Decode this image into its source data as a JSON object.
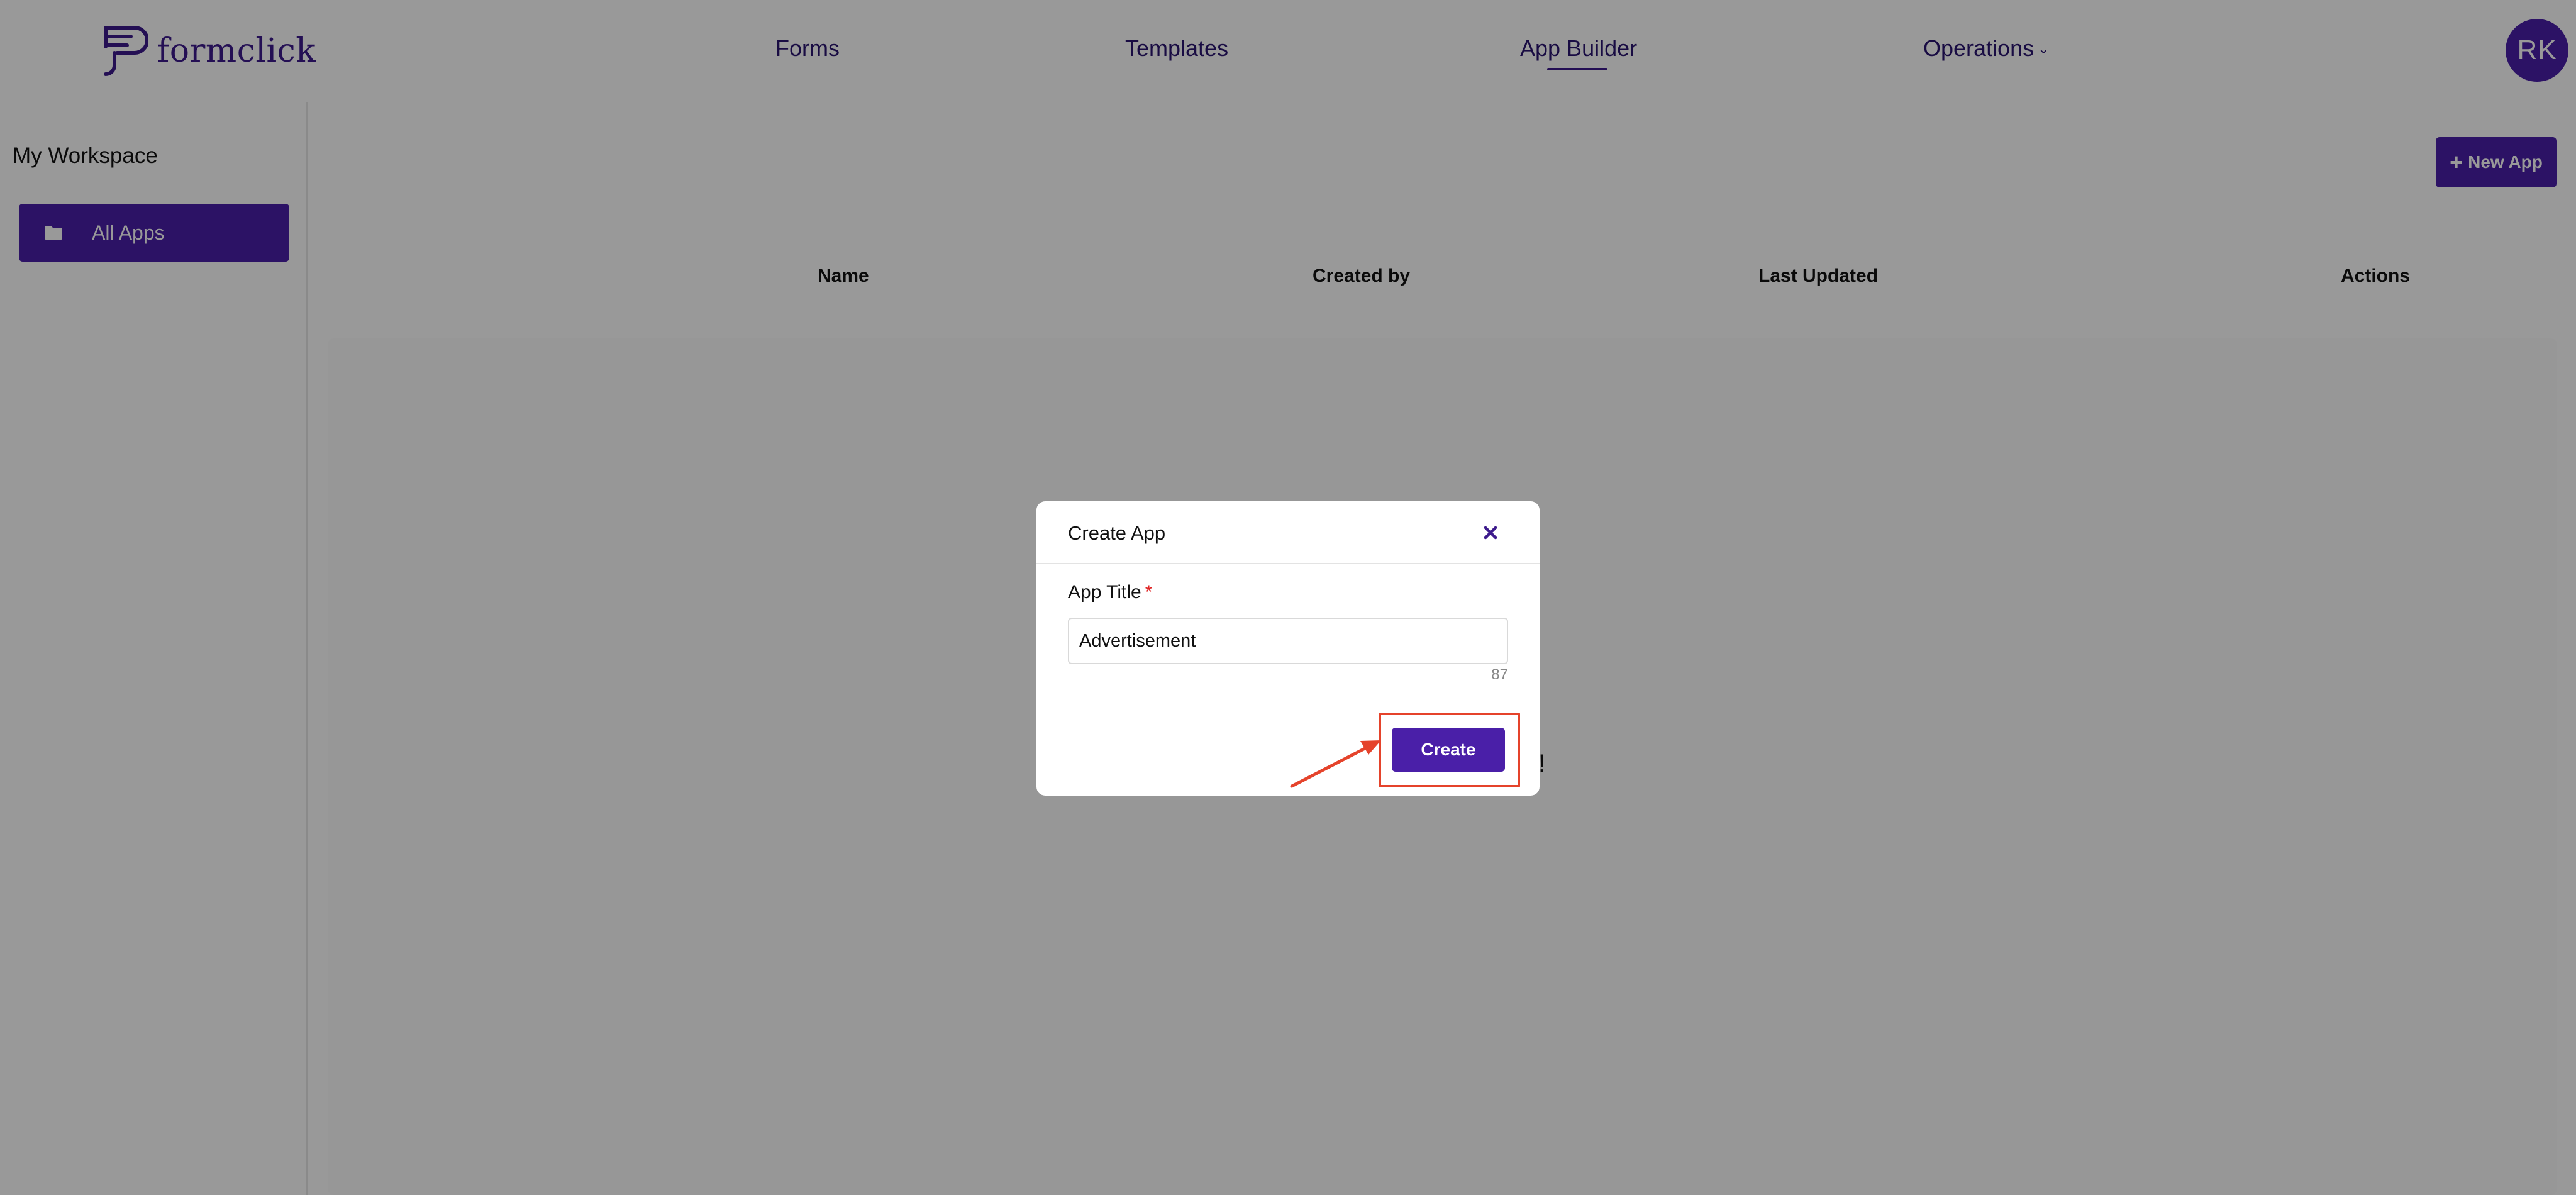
{
  "header": {
    "logo_text": "formclick",
    "nav": {
      "forms": "Forms",
      "templates": "Templates",
      "app_builder": "App Builder",
      "operations": "Operations"
    },
    "active_nav": "App Builder",
    "avatar_initials": "RK"
  },
  "sidebar": {
    "workspace_title": "My Workspace",
    "items": [
      {
        "label": "All Apps",
        "icon": "folder-icon",
        "active": true
      }
    ]
  },
  "main": {
    "new_app_label": "New App",
    "columns": [
      "Name",
      "Created by",
      "Last Updated",
      "Actions"
    ],
    "partial_text": "!"
  },
  "modal": {
    "title": "Create App",
    "field_label": "App Title",
    "required_mark": "*",
    "input_value": "Advertisement",
    "char_count": "87",
    "create_label": "Create"
  },
  "colors": {
    "brand": "#4a1fa8",
    "nav_text": "#2a1470",
    "annotation": "#e5432b",
    "required": "#e02424"
  }
}
